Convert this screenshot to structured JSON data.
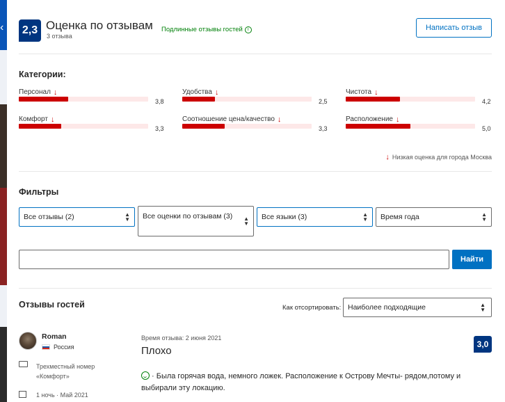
{
  "header": {
    "score": "2,3",
    "title": "Оценка по отзывам",
    "count": "3 отзыва",
    "verified": "Подлинные отзывы гостей",
    "write_review": "Написать отзыв"
  },
  "categories": {
    "heading": "Категории:",
    "items": [
      {
        "label": "Персонал",
        "value": "3,8",
        "fraction": 0.38
      },
      {
        "label": "Удобства",
        "value": "2,5",
        "fraction": 0.25
      },
      {
        "label": "Чистота",
        "value": "4,2",
        "fraction": 0.42
      },
      {
        "label": "Комфорт",
        "value": "3,3",
        "fraction": 0.33
      },
      {
        "label": "Соотношение цена/качество",
        "value": "3,3",
        "fraction": 0.33
      },
      {
        "label": "Расположение",
        "value": "5,0",
        "fraction": 0.5
      }
    ],
    "low_note": "Низкая оценка для города Москва"
  },
  "filters": {
    "heading": "Фильтры",
    "selects": [
      {
        "value": "Все отзывы (2)"
      },
      {
        "value": "Все оценки по отзывам (3)"
      },
      {
        "value": "Все языки (3)"
      },
      {
        "value": "Время года"
      }
    ],
    "search_placeholder": "",
    "find_button": "Найти"
  },
  "reviews": {
    "heading": "Отзывы гостей",
    "sort_label": "Как отсортировать:",
    "sort_value": "Наиболее подходящие",
    "items": [
      {
        "name": "Roman",
        "country": "Россия",
        "room": "Трехместный номер «Комфорт»",
        "stay": "1 ночь · Май 2021",
        "date": "Время отзыва: 2 июня 2021",
        "title": "Плохо",
        "score": "3,0",
        "text": "· Была горячая вода, немного ложек. Расположение к Острову Мечты- рядом,потому и выбирали эту локацию."
      }
    ]
  },
  "colors": {
    "brand_dark": "#003580",
    "brand_blue": "#0071c2",
    "negative": "#cc0000",
    "positive": "#008009"
  }
}
